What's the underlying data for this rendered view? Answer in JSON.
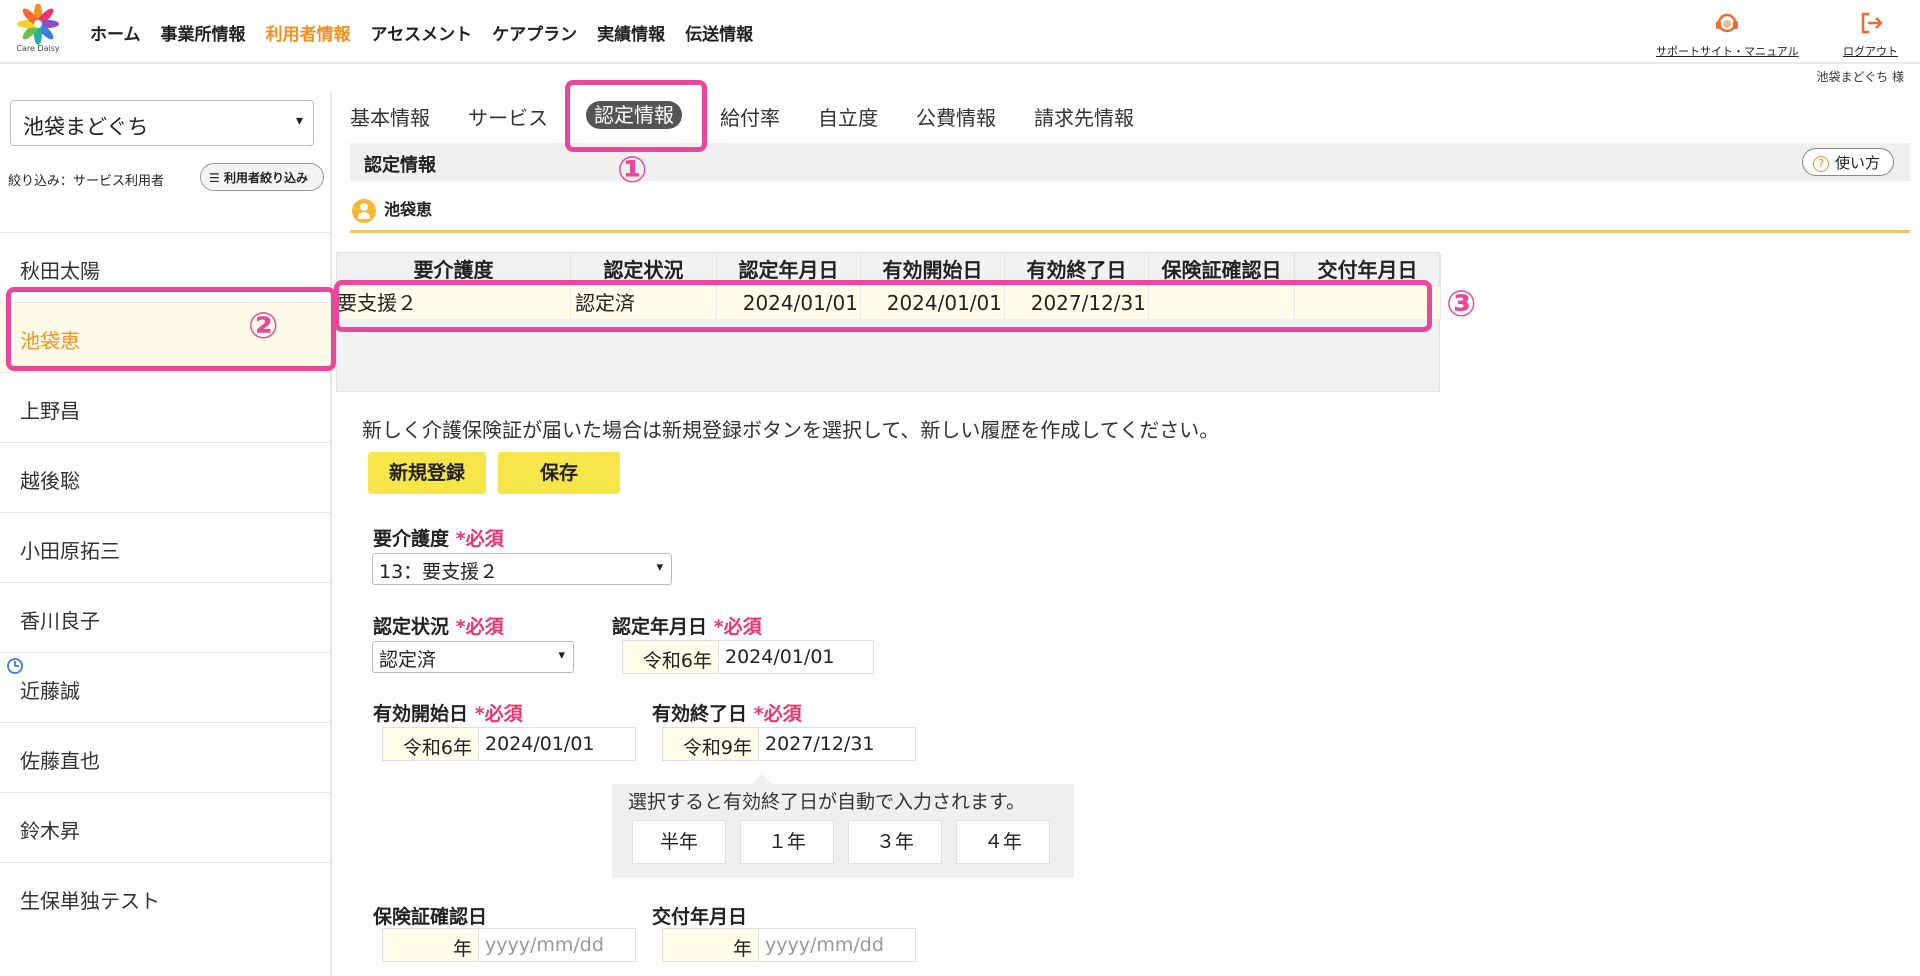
{
  "header": {
    "logo_text": "Care Daisy",
    "nav": [
      "ホーム",
      "事業所情報",
      "利用者情報",
      "アセスメント",
      "ケアプラン",
      "実績情報",
      "伝送情報"
    ],
    "active_nav": "利用者情報",
    "support_label": "サポートサイト・マニュアル",
    "logout_label": "ログアウト",
    "user_greeting": "池袋まどぐち 様",
    "accent_color": "#f39020"
  },
  "sidebar": {
    "office": "池袋まどぐち",
    "filter_label": "絞り込み：サービス利用者",
    "filter_button": "利用者絞り込み",
    "users": [
      "秋田太陽",
      "池袋恵",
      "上野昌",
      "越後聡",
      "小田原拓三",
      "香川良子",
      "近藤誠",
      "佐藤直也",
      "鈴木昇",
      "生保単独テスト"
    ],
    "selected_user": "池袋恵"
  },
  "tabs": [
    "基本情報",
    "サービス",
    "認定情報",
    "給付率",
    "自立度",
    "公費情報",
    "請求先情報"
  ],
  "active_tab": "認定情報",
  "section": {
    "title": "認定情報",
    "help_label": "使い方",
    "person_name": "池袋恵"
  },
  "table": {
    "headers": [
      "要介護度",
      "認定状況",
      "認定年月日",
      "有効開始日",
      "有効終了日",
      "保険証確認日",
      "交付年月日"
    ],
    "rows": [
      [
        "要支援２",
        "認定済",
        "2024/01/01",
        "2024/01/01",
        "2027/12/31",
        "",
        ""
      ]
    ]
  },
  "form": {
    "info_text": "新しく介護保険証が届いた場合は新規登録ボタンを選択して、新しい履歴を作成してください。",
    "new_button": "新規登録",
    "save_button": "保存",
    "required_mark": "*必須",
    "care_level": {
      "label": "要介護度",
      "value": "13：要支援２"
    },
    "cert_status": {
      "label": "認定状況",
      "value": "認定済"
    },
    "cert_date": {
      "label": "認定年月日",
      "era": "令和6年",
      "value": "2024/01/01"
    },
    "start_date": {
      "label": "有効開始日",
      "era": "令和6年",
      "value": "2024/01/01"
    },
    "end_date": {
      "label": "有効終了日",
      "era": "令和9年",
      "value": "2027/12/31"
    },
    "quick_hint": "選択すると有効終了日が自動で入力されます。",
    "quick_options": [
      "半年",
      "１年",
      "３年",
      "４年"
    ],
    "insurance_check": {
      "label": "保険証確認日",
      "era": "年",
      "placeholder": "yyyy/mm/dd"
    },
    "issue_date": {
      "label": "交付年月日",
      "era": "年",
      "placeholder": "yyyy/mm/dd"
    }
  },
  "annotations": [
    "①",
    "②",
    "③"
  ]
}
